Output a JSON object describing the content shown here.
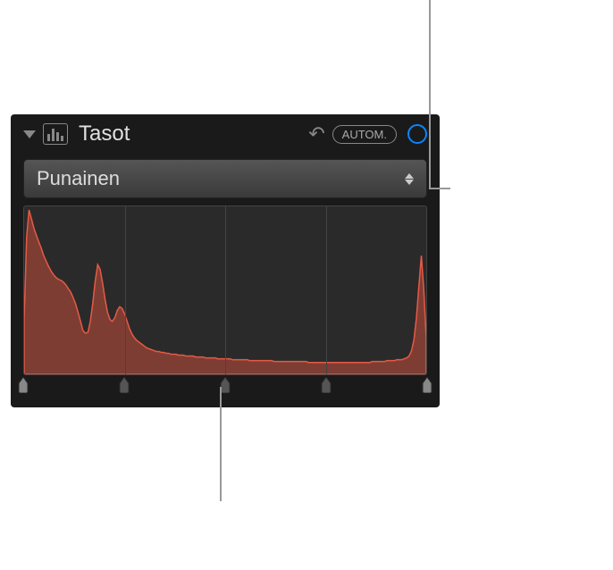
{
  "panel": {
    "title": "Tasot",
    "auto_label": "AUTOM.",
    "channel_selected": "Punainen"
  },
  "histogram": {
    "color_fill": "rgba(210,80,60,0.5)",
    "color_stroke": "rgb(230,90,70)",
    "grid_positions_pct": [
      25,
      50,
      75
    ],
    "values": [
      60,
      150,
      180,
      170,
      160,
      152,
      145,
      138,
      130,
      124,
      118,
      113,
      109,
      106,
      104,
      103,
      101,
      98,
      94,
      90,
      84,
      77,
      68,
      58,
      48,
      45,
      46,
      58,
      78,
      102,
      120,
      115,
      100,
      82,
      68,
      60,
      58,
      62,
      70,
      74,
      72,
      66,
      58,
      50,
      44,
      40,
      37,
      35,
      33,
      31,
      29,
      28,
      27,
      26,
      25,
      25,
      24,
      24,
      23,
      23,
      22,
      22,
      22,
      21,
      21,
      21,
      20,
      20,
      20,
      20,
      19,
      19,
      19,
      19,
      18,
      18,
      18,
      18,
      18,
      17,
      17,
      17,
      17,
      17,
      17,
      16,
      16,
      16,
      16,
      16,
      16,
      16,
      15,
      15,
      15,
      15,
      15,
      15,
      15,
      15,
      15,
      15,
      14,
      14,
      14,
      14,
      14,
      14,
      14,
      14,
      14,
      14,
      14,
      14,
      14,
      14,
      13,
      13,
      13,
      13,
      13,
      13,
      13,
      13,
      13,
      13,
      13,
      13,
      13,
      13,
      13,
      13,
      13,
      13,
      13,
      13,
      13,
      13,
      13,
      13,
      13,
      13,
      14,
      14,
      14,
      14,
      14,
      14,
      15,
      15,
      15,
      15,
      16,
      16,
      16,
      17,
      18,
      20,
      26,
      38,
      62,
      96,
      130,
      93,
      40
    ]
  },
  "sliders": {
    "positions_pct": [
      0,
      25,
      50,
      75,
      100
    ]
  }
}
